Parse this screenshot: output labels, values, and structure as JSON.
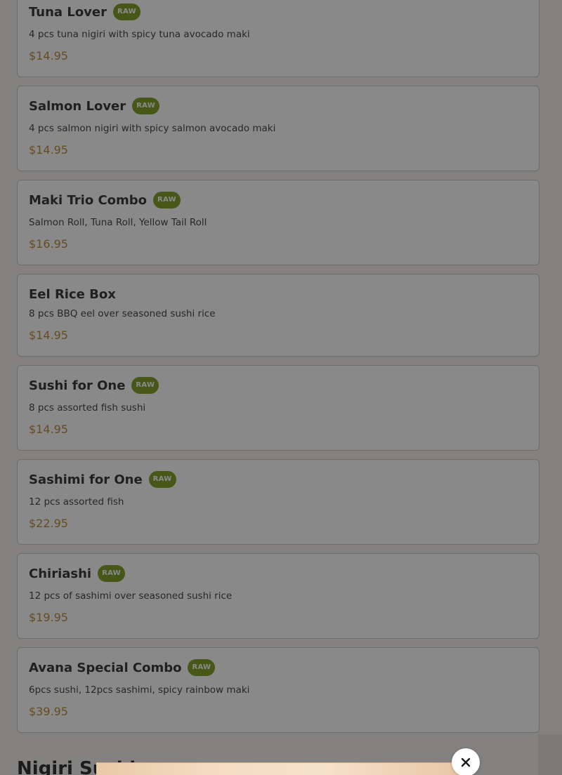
{
  "menu": {
    "items": [
      {
        "name": "Tuna Lover",
        "badge": "RAW",
        "description": "4 pcs tuna nigiri with spicy tuna avocado maki",
        "price": "$14.95"
      },
      {
        "name": "Salmon Lover",
        "badge": "RAW",
        "description": "4 pcs salmon nigiri with spicy salmon avocado maki",
        "price": "$14.95"
      },
      {
        "name": "Maki Trio Combo",
        "badge": "RAW",
        "description": "Salmon Roll, Tuna Roll, Yellow Tail Roll",
        "price": "$16.95"
      },
      {
        "name": "Eel Rice Box",
        "badge": "",
        "description": "8 pcs BBQ eel over seasoned sushi rice",
        "price": "$14.95"
      },
      {
        "name": "Sushi for One",
        "badge": "RAW",
        "description": "8 pcs assorted fish sushi",
        "price": "$14.95"
      },
      {
        "name": "Sashimi for One",
        "badge": "RAW",
        "description": "12 pcs assorted fish",
        "price": "$22.95"
      },
      {
        "name": "Chiriashi",
        "badge": "RAW",
        "description": "12 pcs of sashimi over seasoned sushi rice",
        "price": "$19.95"
      },
      {
        "name": "Avana Special Combo",
        "badge": "RAW",
        "description": "6pcs sushi, 12pcs sashimi, spicy rainbow maki",
        "price": "$39.95"
      }
    ],
    "next_section_heading": "Nigiri Sushi"
  },
  "modal": {
    "close_icon": "close-icon"
  },
  "colors": {
    "badge_bg": "#7a9b1c",
    "price": "#b8862e",
    "overlay": "rgba(20,20,20,0.5)"
  }
}
